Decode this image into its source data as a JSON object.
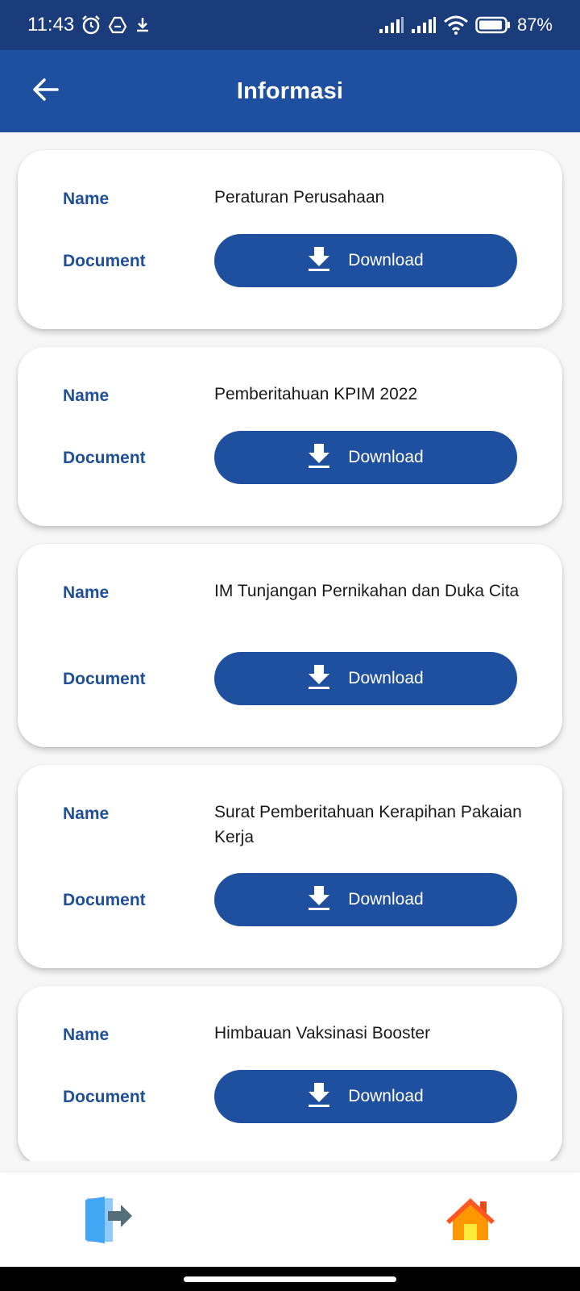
{
  "status_bar": {
    "time": "11:43",
    "battery": "87%",
    "icons": [
      "alarm-icon",
      "drive-icon",
      "download-icon",
      "signal-icon",
      "signal-icon",
      "wifi-icon",
      "battery-icon"
    ]
  },
  "app_bar": {
    "title": "Informasi",
    "back_icon": "arrow-left-icon"
  },
  "labels": {
    "name": "Name",
    "document": "Document",
    "download": "Download"
  },
  "documents": [
    {
      "name": "Peraturan Perusahaan"
    },
    {
      "name": "Pemberitahuan KPIM 2022"
    },
    {
      "name": "IM Tunjangan Pernikahan dan Duka Cita"
    },
    {
      "name": "Surat Pemberitahuan Kerapihan Pakaian Kerja"
    },
    {
      "name": "Himbauan Vaksinasi Booster"
    }
  ],
  "bottom_nav": {
    "left_icon": "logout-icon",
    "right_icon": "home-icon"
  },
  "colors": {
    "primary": "#1f50a0",
    "status_bar": "#1b3c7a",
    "label_text": "#1f4f98",
    "home_icon": "#ff7a2f",
    "logout_icon": "#42a5f5"
  }
}
